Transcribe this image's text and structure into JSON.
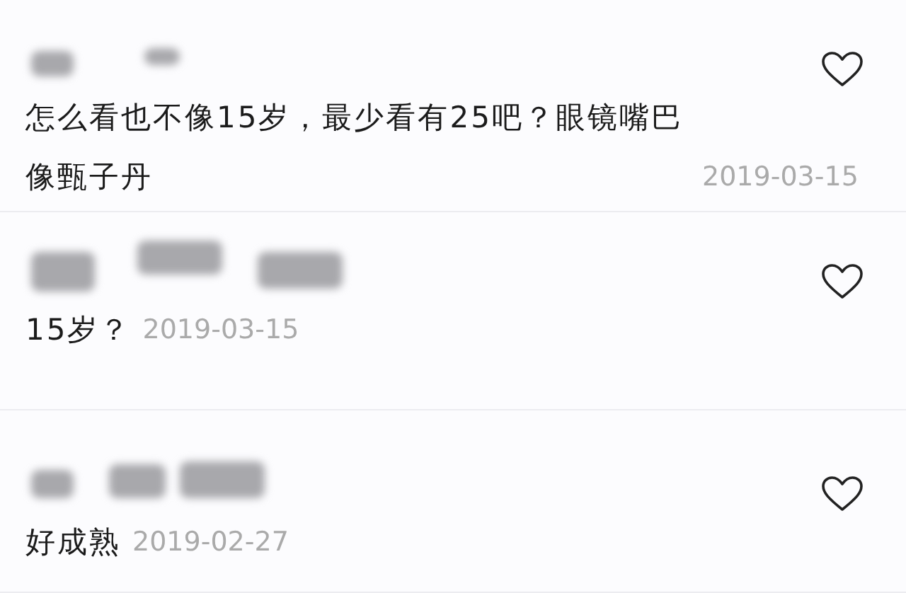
{
  "comments": [
    {
      "text": "怎么看也不像15岁，最少看有25吧？眼镜嘴巴像甄子丹",
      "date": "2019-03-15"
    },
    {
      "text": "15岁？",
      "date": "2019-03-15"
    },
    {
      "text": "好成熟",
      "date": "2019-02-27"
    }
  ]
}
